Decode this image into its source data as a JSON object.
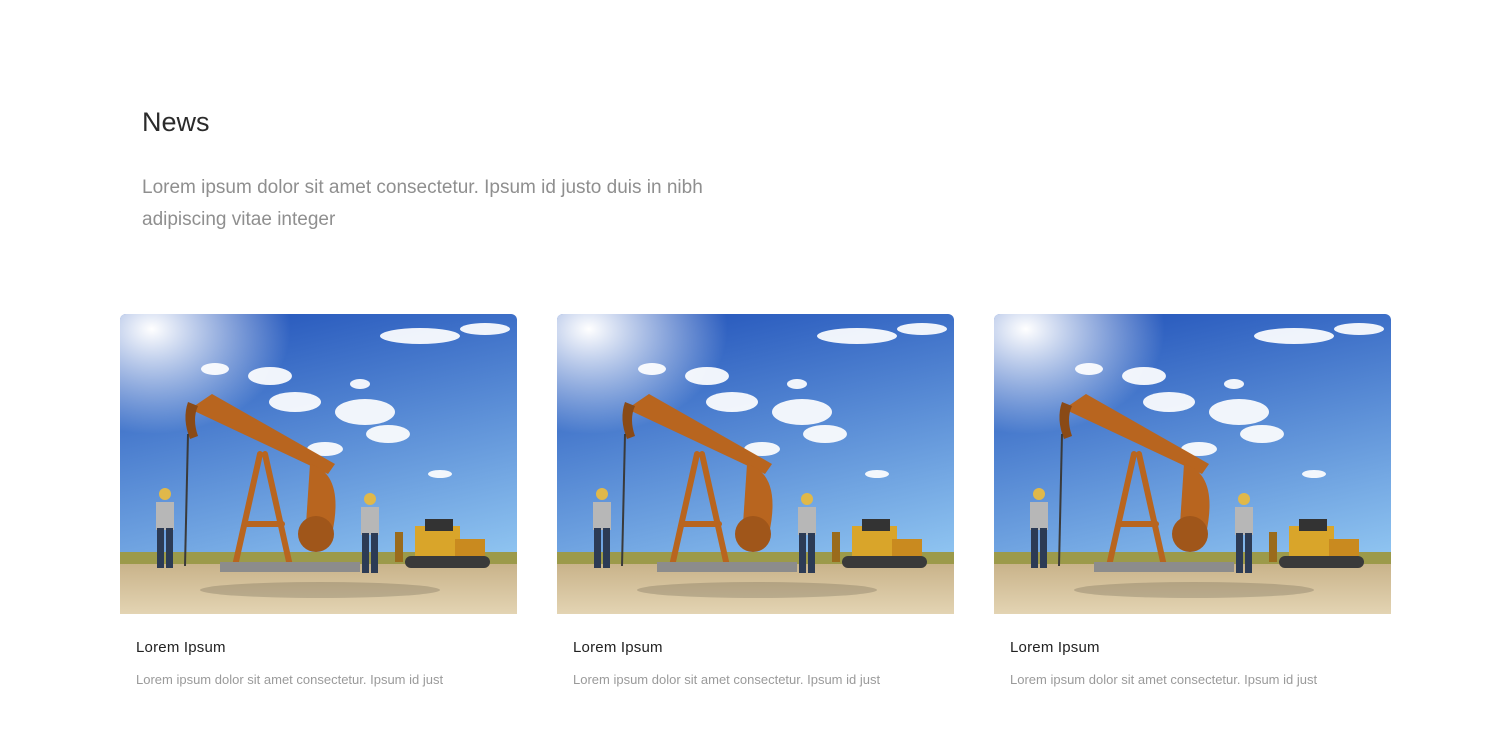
{
  "section": {
    "title": "News",
    "description": "Lorem ipsum dolor sit amet consectetur. Ipsum id justo duis in nibh adipiscing vitae integer"
  },
  "cards": [
    {
      "title": "Lorem Ipsum",
      "excerpt": "Lorem ipsum dolor sit amet consectetur. Ipsum id just",
      "image": "oil-pumpjack-workers-photo"
    },
    {
      "title": "Lorem Ipsum",
      "excerpt": "Lorem ipsum dolor sit amet consectetur. Ipsum id just",
      "image": "oil-pumpjack-workers-photo"
    },
    {
      "title": "Lorem Ipsum",
      "excerpt": "Lorem ipsum dolor sit amet consectetur. Ipsum id just",
      "image": "oil-pumpjack-workers-photo"
    }
  ],
  "colors": {
    "heading": "#2b2b2b",
    "muted": "#8f8f8f",
    "sky_top": "#1e4fb8",
    "sky_bottom": "#8ec3f0",
    "pumpjack": "#b8651f"
  }
}
